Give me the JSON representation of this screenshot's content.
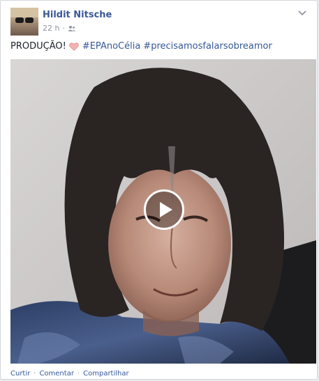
{
  "post": {
    "author": "Hildit Nitsche",
    "time": "22 h",
    "audience_icon": "friends-icon",
    "caption": {
      "text": "PRODUÇÃO!",
      "emoji": "heart-icon",
      "hashtags": [
        "#EPAnoCélia",
        "#precisamosfalarsobreamor"
      ]
    },
    "video": {
      "play_icon": "play-icon"
    },
    "actions": {
      "like": "Curtir",
      "comment": "Comentar",
      "share": "Compartilhar",
      "separator": "·"
    }
  },
  "colors": {
    "link": "#365899",
    "author": "#3b5998",
    "meta": "#90949c",
    "text": "#1d2129",
    "heart": "#f0a8a8"
  }
}
